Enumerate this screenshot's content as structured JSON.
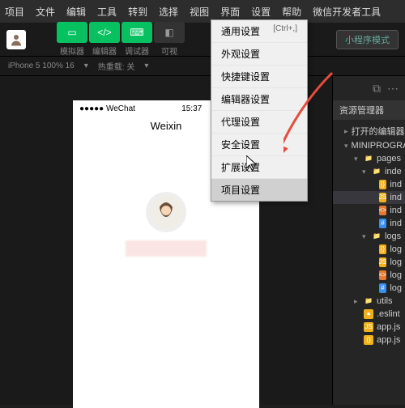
{
  "menubar": [
    "项目",
    "文件",
    "编辑",
    "工具",
    "转到",
    "选择",
    "视图",
    "界面",
    "设置",
    "帮助",
    "微信开发者工具"
  ],
  "toolbar": {
    "buttons": [
      {
        "label": "模拟器"
      },
      {
        "label": "编辑器"
      },
      {
        "label": "调试器"
      },
      {
        "label": "可视"
      }
    ],
    "mode": "小程序模式"
  },
  "subbar": {
    "device": "iPhone 5 100% 16",
    "hot": "热重载: 关"
  },
  "phone": {
    "carrier": "●●●●● WeChat",
    "time": "15:37",
    "title": "Weixin"
  },
  "dropdown": [
    {
      "label": "通用设置",
      "shortcut": "[Ctrl+,]"
    },
    {
      "label": "外观设置"
    },
    {
      "label": "快捷键设置"
    },
    {
      "label": "编辑器设置"
    },
    {
      "label": "代理设置"
    },
    {
      "label": "安全设置"
    },
    {
      "label": "扩展设置"
    },
    {
      "label": "项目设置",
      "hover": true
    }
  ],
  "panel": {
    "title": "资源管理器",
    "openEditors": "打开的编辑器",
    "root": "MINIPROGRAM",
    "tree": [
      {
        "l": 2,
        "caret": "▾",
        "cls": "folder",
        "icon": "📁",
        "name": "pages"
      },
      {
        "l": 3,
        "caret": "▾",
        "cls": "folder",
        "icon": "📁",
        "name": "inde"
      },
      {
        "l": 4,
        "caret": "",
        "cls": "json",
        "icon": "{}",
        "name": "ind"
      },
      {
        "l": 4,
        "caret": "",
        "cls": "js",
        "icon": "JS",
        "name": "ind",
        "sel": true
      },
      {
        "l": 4,
        "caret": "",
        "cls": "wxml",
        "icon": "<>",
        "name": "ind"
      },
      {
        "l": 4,
        "caret": "",
        "cls": "wxss",
        "icon": "#",
        "name": "ind"
      },
      {
        "l": 3,
        "caret": "▾",
        "cls": "folder",
        "icon": "📁",
        "name": "logs"
      },
      {
        "l": 4,
        "caret": "",
        "cls": "json",
        "icon": "{}",
        "name": "log"
      },
      {
        "l": 4,
        "caret": "",
        "cls": "js",
        "icon": "JS",
        "name": "log"
      },
      {
        "l": 4,
        "caret": "",
        "cls": "wxml",
        "icon": "<>",
        "name": "log"
      },
      {
        "l": 4,
        "caret": "",
        "cls": "wxss",
        "icon": "#",
        "name": "log"
      },
      {
        "l": 2,
        "caret": "▸",
        "cls": "folder",
        "icon": "📁",
        "name": "utils"
      },
      {
        "l": 2,
        "caret": "",
        "cls": "json",
        "icon": "●",
        "name": ".eslint"
      },
      {
        "l": 2,
        "caret": "",
        "cls": "js",
        "icon": "JS",
        "name": "app.js"
      },
      {
        "l": 2,
        "caret": "",
        "cls": "json",
        "icon": "{}",
        "name": "app.js"
      }
    ]
  }
}
